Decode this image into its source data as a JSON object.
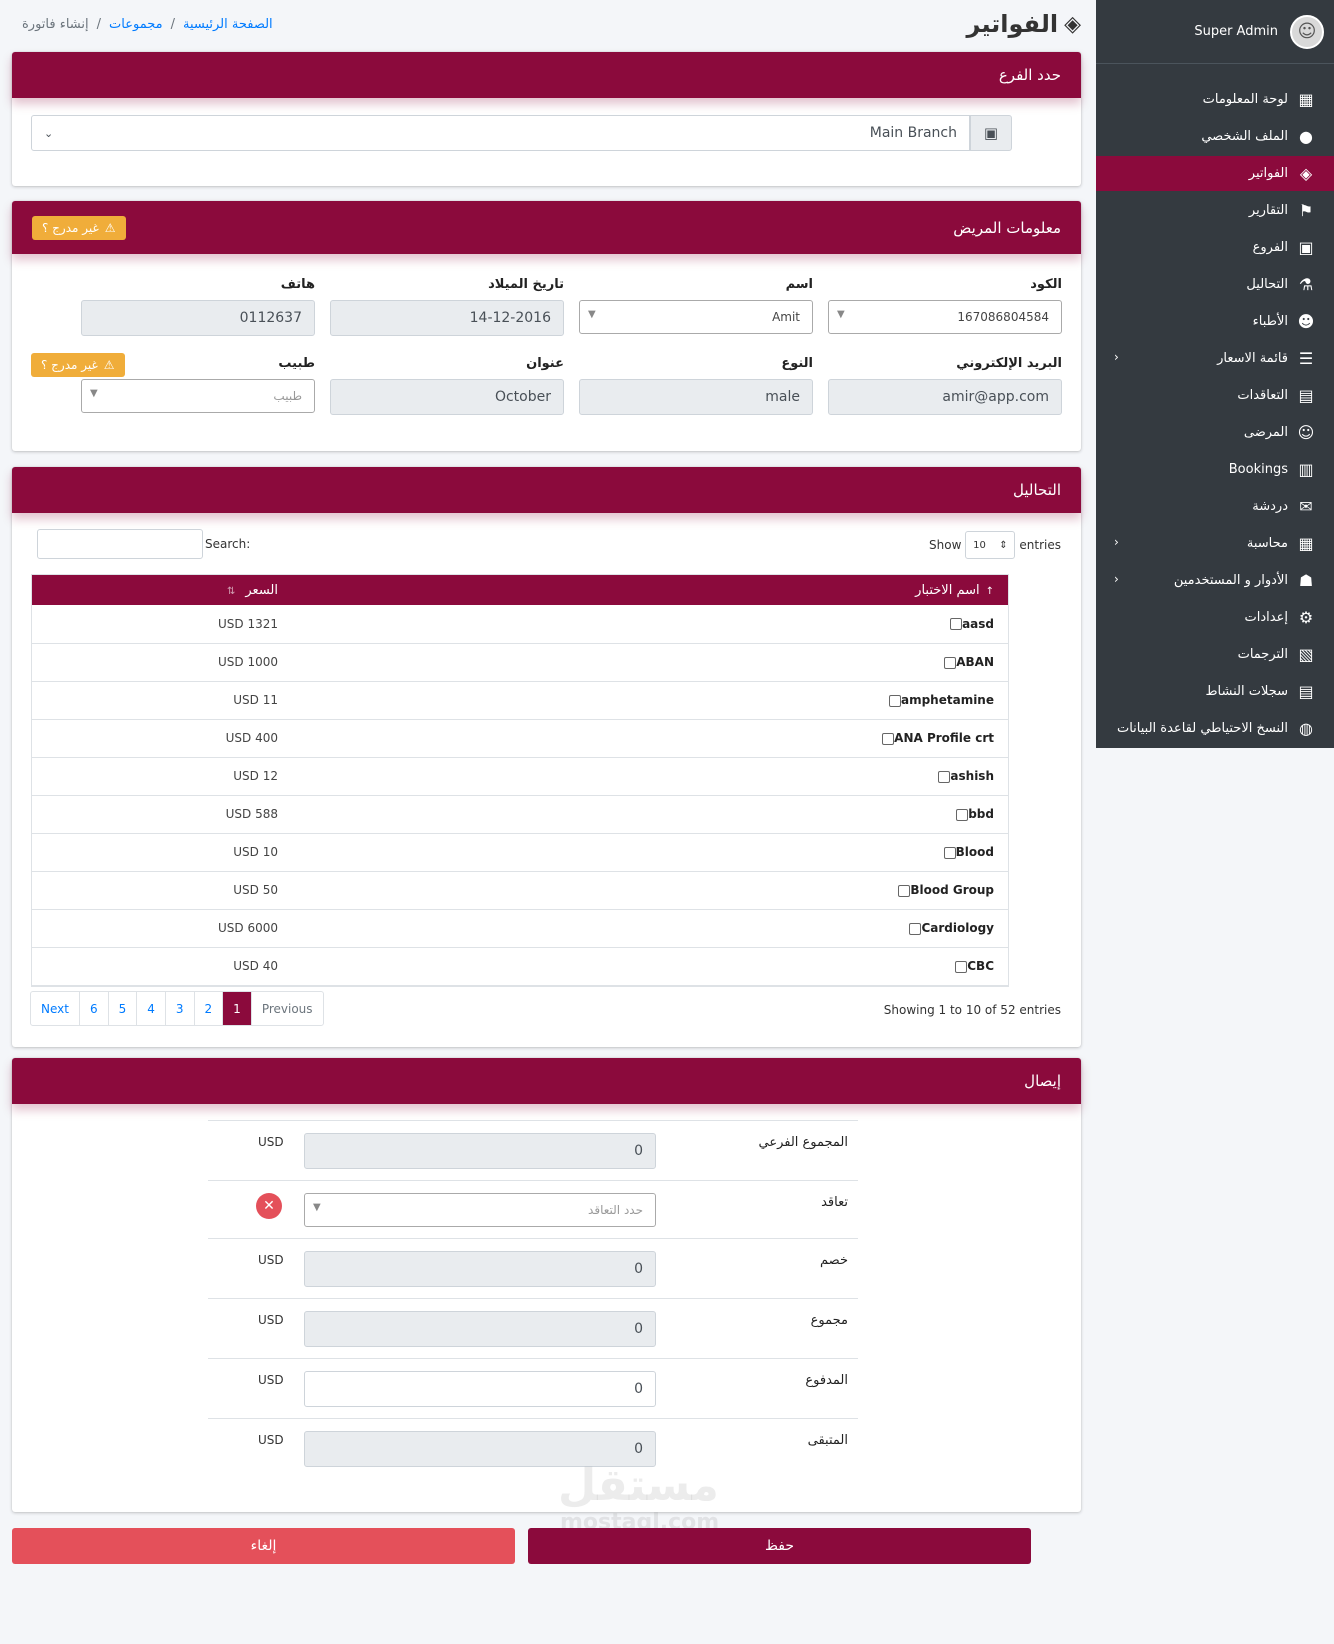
{
  "user": {
    "name": "Super Admin"
  },
  "sidebar": {
    "items": [
      {
        "label": "لوحة المعلومات",
        "icon": "▦",
        "active": false,
        "arrow": false
      },
      {
        "label": "الملف الشخصي",
        "icon": "●",
        "active": false,
        "arrow": false
      },
      {
        "label": "الفواتير",
        "icon": "◈",
        "active": true,
        "arrow": false
      },
      {
        "label": "التقارير",
        "icon": "⚑",
        "active": false,
        "arrow": false
      },
      {
        "label": "الفروع",
        "icon": "▣",
        "active": false,
        "arrow": false
      },
      {
        "label": "التحاليل",
        "icon": "⚗",
        "active": false,
        "arrow": false
      },
      {
        "label": "الأطباء",
        "icon": "☻",
        "active": false,
        "arrow": false
      },
      {
        "label": "قائمة الاسعار",
        "icon": "☰",
        "active": false,
        "arrow": true
      },
      {
        "label": "التعاقدات",
        "icon": "▤",
        "active": false,
        "arrow": false
      },
      {
        "label": "المرضى",
        "icon": "☺",
        "active": false,
        "arrow": false
      },
      {
        "label": "Bookings",
        "icon": "▥",
        "active": false,
        "arrow": false
      },
      {
        "label": "دردشة",
        "icon": "✉",
        "active": false,
        "arrow": false
      },
      {
        "label": "محاسبة",
        "icon": "▦",
        "active": false,
        "arrow": true
      },
      {
        "label": "الأدوار و المستخدمين",
        "icon": "☗",
        "active": false,
        "arrow": true
      },
      {
        "label": "إعدادات",
        "icon": "⚙",
        "active": false,
        "arrow": false
      },
      {
        "label": "الترجمات",
        "icon": "▧",
        "active": false,
        "arrow": false
      },
      {
        "label": "سجلات النشاط",
        "icon": "▤",
        "active": false,
        "arrow": false
      },
      {
        "label": "النسخ الاحتياطي لقاعدة البيانات",
        "icon": "◍",
        "active": false,
        "arrow": false
      }
    ]
  },
  "header": {
    "title": "الفواتير",
    "breadcrumb": {
      "home": "الصفحة الرئيسية",
      "groups": "مجموعات",
      "current": "إنشاء فاتورة",
      "sep": "/"
    }
  },
  "branch": {
    "title": "حدد الفرع",
    "value": "Main Branch"
  },
  "patient": {
    "title": "معلومات المريض",
    "badge": "غير مدرج ؟",
    "code_label": "الكود",
    "code_value": "167086804584",
    "name_label": "اسم",
    "name_value": "Amit",
    "dob_label": "تاريخ الميلاد",
    "dob_value": "14-12-2016",
    "phone_label": "هاتف",
    "phone_value": "0112637",
    "email_label": "البريد الإلكتروني",
    "email_value": "amir@app.com",
    "gender_label": "النوع",
    "gender_value": "male",
    "address_label": "عنوان",
    "address_value": "October",
    "doctor_label": "طبيب",
    "doctor_placeholder": "طبيب",
    "doctor_badge": "غير مدرج ؟"
  },
  "tests": {
    "title": "التحاليل",
    "show_label": "Show",
    "entries_label": "entries",
    "page_length": "10",
    "search_label": "Search:",
    "col_name": "اسم الاختبار",
    "col_price": "السعر",
    "rows": [
      {
        "name": "aasd",
        "price": "USD 1321"
      },
      {
        "name": "ABAN",
        "price": "USD 1000"
      },
      {
        "name": "amphetamine",
        "price": "USD 11"
      },
      {
        "name": "ANA Profile crt",
        "price": "USD 400"
      },
      {
        "name": "ashish",
        "price": "USD 12"
      },
      {
        "name": "bbd",
        "price": "USD 588"
      },
      {
        "name": "Blood",
        "price": "USD 10"
      },
      {
        "name": "Blood Group",
        "price": "USD 50"
      },
      {
        "name": "Cardiology",
        "price": "USD 6000"
      },
      {
        "name": "CBC",
        "price": "USD 40"
      }
    ],
    "info": "Showing 1 to 10 of 52 entries",
    "pager": {
      "previous": "Previous",
      "next": "Next",
      "pages": [
        "1",
        "2",
        "3",
        "4",
        "5",
        "6"
      ]
    }
  },
  "receipt": {
    "title": "إيصال",
    "currency": "USD",
    "subtotal_label": "المجموع الفرعي",
    "subtotal_value": "0",
    "contract_label": "تعاقد",
    "contract_placeholder": "حدد التعاقد",
    "discount_label": "خصم",
    "discount_value": "0",
    "total_label": "مجموع",
    "total_value": "0",
    "paid_label": "المدفوع",
    "paid_value": "0",
    "due_label": "المتبقى",
    "due_value": "0"
  },
  "actions": {
    "save": "حفظ",
    "cancel": "إلغاء"
  },
  "watermark": {
    "ar": "مستقل",
    "en": "mostaql.com"
  }
}
